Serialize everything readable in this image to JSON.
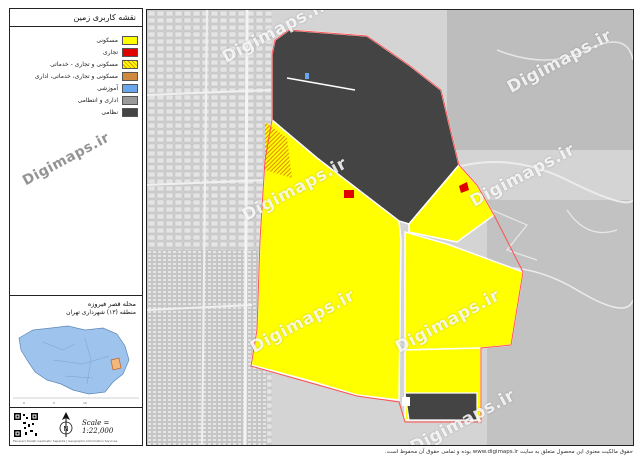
{
  "legend": {
    "title": "نقشه کاربری زمین",
    "items": [
      {
        "label": "مسکونی",
        "color": "#ffff00",
        "icon": "solid"
      },
      {
        "label": "تجاری",
        "color": "#e00000",
        "icon": "solid"
      },
      {
        "label": "مسکونی و تجاری - خدماتی",
        "color": "#e8a800",
        "icon": "hatch-orange"
      },
      {
        "label": "مسکونی و تجاری، خدماتی، اداری",
        "color": "#d08a40",
        "icon": "solid"
      },
      {
        "label": "آموزشی",
        "color": "#6aa6ec",
        "icon": "solid"
      },
      {
        "label": "اداری و انتظامی",
        "color": "#9a9a9a",
        "icon": "solid"
      },
      {
        "label": "نظامی",
        "color": "#444444",
        "icon": "solid"
      }
    ]
  },
  "district": {
    "name": "محله قصر فیروزه",
    "region": "منطقه (۱۳) شهرداری تهران"
  },
  "scale": "Scale = 1:22,000",
  "north_symbol": "N",
  "tiny_footer": "Fanavari Dadeh Geomatic Sepanta | Geographic Information Services",
  "watermark": "Digimaps.ir",
  "footer_note": "حقوق مالکیت معنوی این محصول متعلق به سایت www.digimaps.ir بوده و تمامی حقوق آن محفوظ است.",
  "colors": {
    "residential": "#ffff00",
    "military": "#444444",
    "commercial": "#e00000",
    "educational": "#6aa6ec",
    "boundary": "#e06060",
    "base": "#d2d2d2"
  }
}
